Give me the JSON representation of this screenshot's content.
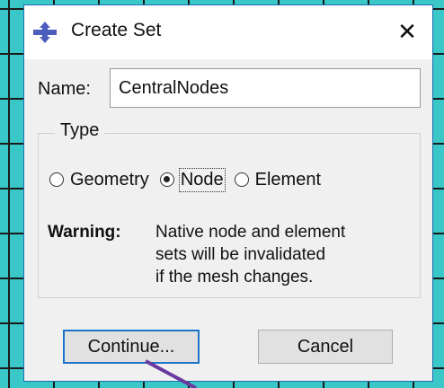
{
  "dialog": {
    "title": "Create Set",
    "close_glyph": "✕",
    "app_icon": "arrows-cross-icon"
  },
  "name_field": {
    "label": "Name:",
    "value": "CentralNodes"
  },
  "type_group": {
    "legend": "Type",
    "options": [
      {
        "label": "Geometry",
        "checked": false
      },
      {
        "label": "Node",
        "checked": true
      },
      {
        "label": "Element",
        "checked": false
      }
    ]
  },
  "warning": {
    "heading": "Warning:",
    "lines": [
      "Native node and element",
      "sets will be invalidated",
      "if the mesh changes."
    ]
  },
  "buttons": {
    "continue_label": "Continue...",
    "cancel_label": "Cancel"
  },
  "colors": {
    "background_mesh": "#39c7c7",
    "accent": "#1c74c9",
    "pointer": "#6a3aa0"
  }
}
